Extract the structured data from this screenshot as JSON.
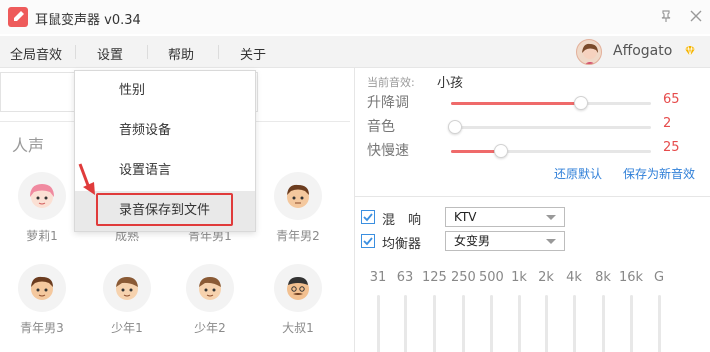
{
  "window": {
    "title": "耳鼠变声器 v0.34",
    "pin_icon": "pin-icon",
    "close_icon": "close-icon"
  },
  "menubar": {
    "items": [
      "全局音效",
      "设置",
      "帮助",
      "关于"
    ],
    "user": {
      "name": "Affogato",
      "badge_icon": "vip-diamond-icon"
    }
  },
  "left": {
    "section_label": "人声",
    "voices": [
      {
        "label": "萝莉1"
      },
      {
        "label": "成熟"
      },
      {
        "label": "青年男1"
      },
      {
        "label": "青年男2"
      },
      {
        "label": "青年男3"
      },
      {
        "label": "少年1"
      },
      {
        "label": "少年2"
      },
      {
        "label": "大叔1"
      }
    ]
  },
  "dropdown": {
    "items": [
      "性别",
      "音频设备",
      "设置语言",
      "录音保存到文件"
    ],
    "highlighted_index": 3
  },
  "right": {
    "current_label": "当前音效:",
    "current_value": "小孩",
    "sliders": [
      {
        "name": "升降调",
        "value": "65",
        "level": 0.65
      },
      {
        "name": "音色",
        "value": "2",
        "level": 0.02
      },
      {
        "name": "快慢速",
        "value": "25",
        "level": 0.25
      }
    ],
    "reset_link": "还原默认",
    "save_link": "保存为新音效",
    "reverb": {
      "label": "混　响",
      "value": "KTV",
      "checked": true
    },
    "equalizer": {
      "label": "均衡器",
      "value": "女变男",
      "checked": true
    },
    "eq_bands": [
      "31",
      "63",
      "125",
      "250",
      "500",
      "1k",
      "2k",
      "4k",
      "8k",
      "16k",
      "G"
    ]
  },
  "colors": {
    "accent": "#ef6a6a",
    "link": "#2f7fd8",
    "annotation": "#e03b3b"
  }
}
